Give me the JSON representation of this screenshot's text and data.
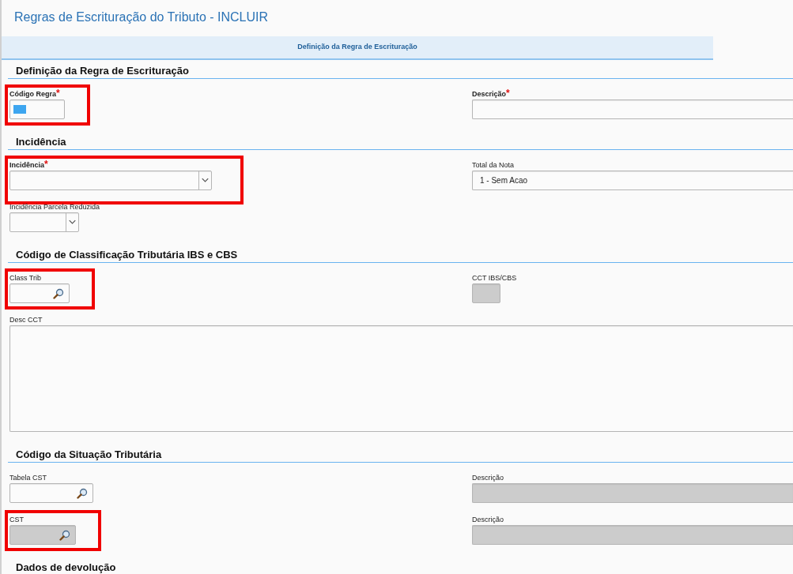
{
  "page_title": "Regras de Escrituração do Tributo - INCLUIR",
  "tabs": [
    {
      "label": "Definição da Regra de Escrituração",
      "selected": true
    }
  ],
  "sections": [
    {
      "title": "Definição da Regra de Escrituração",
      "rows": [
        [
          {
            "label": "Código Regra",
            "required_mark": "*",
            "kind": "text",
            "disabled": false,
            "highlighted": true,
            "text_selected": true
          },
          {
            "label": "Descrição",
            "required_mark": "*",
            "kind": "text",
            "disabled": false,
            "highlighted": false
          }
        ]
      ]
    },
    {
      "title": "Incidência",
      "rows": [
        [
          {
            "label": "Incidência",
            "required_mark": "*",
            "kind": "select",
            "disabled": false,
            "highlighted": true
          },
          {
            "label": "Total da Nota",
            "kind": "text",
            "value": "1 - Sem Acao",
            "disabled": false,
            "highlighted": false
          }
        ],
        [
          {
            "label": "Incidência Parcela Reduzida",
            "kind": "select",
            "disabled": false,
            "highlighted": false
          }
        ]
      ]
    },
    {
      "title": "Código de Classificação Tributária IBS e CBS",
      "rows": [
        [
          {
            "label": "Class Trib",
            "kind": "lookup",
            "disabled": false,
            "highlighted": true
          },
          {
            "label": "CCT IBS/CBS",
            "kind": "text",
            "disabled": true,
            "highlighted": false
          }
        ],
        [
          {
            "label": "Desc CCT",
            "kind": "textarea",
            "disabled": false,
            "highlighted": false
          }
        ]
      ]
    },
    {
      "title": "Código da Situação Tributária",
      "rows": [
        [
          {
            "label": "Tabela CST",
            "kind": "lookup",
            "disabled": false,
            "highlighted": false
          },
          {
            "label": "Descrição",
            "kind": "text",
            "disabled": true,
            "highlighted": false
          }
        ],
        [
          {
            "label": "CST",
            "kind": "lookup",
            "disabled": true,
            "highlighted": true
          },
          {
            "label": "Descrição",
            "kind": "text",
            "disabled": true,
            "highlighted": false
          }
        ]
      ]
    },
    {
      "title": "Dados de devolução"
    }
  ]
}
